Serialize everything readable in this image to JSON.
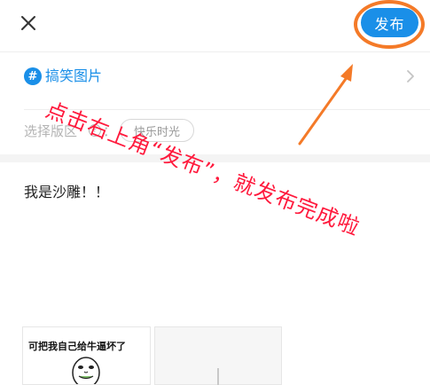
{
  "header": {
    "close_icon": "close-icon",
    "publish_label": "发布"
  },
  "topic": {
    "icon": "hash-icon",
    "icon_glyph": "#",
    "label": "搞笑图片",
    "chevron_icon": "chevron-right-icon"
  },
  "board": {
    "label": "选择版区",
    "help_glyph": "?",
    "colon": "：",
    "chip": "快乐时光"
  },
  "post": {
    "text": "我是沙雕！！"
  },
  "images": [
    {
      "caption": "可把我自己给牛逼坏了"
    }
  ],
  "annotation": {
    "text": "点击右上角“发布”，就发布完成啦",
    "color": "#ff1a3d",
    "arrow_color": "#f47a28"
  },
  "colors": {
    "accent": "#1a8fe8",
    "muted": "#b4b4b4"
  }
}
